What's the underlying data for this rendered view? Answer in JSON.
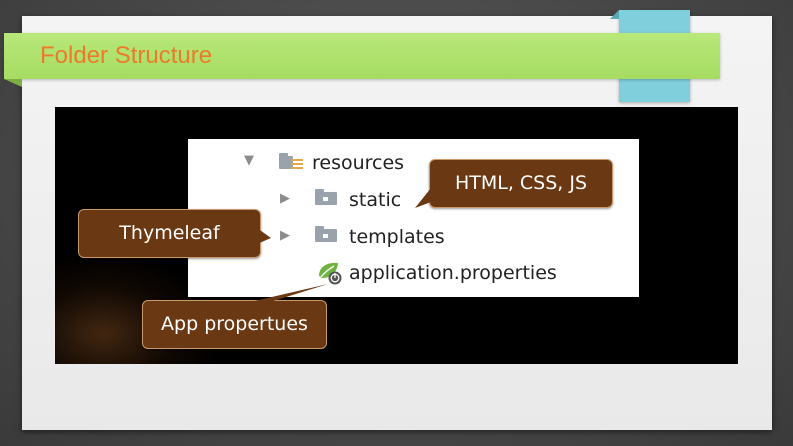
{
  "slide": {
    "title": "Folder Structure"
  },
  "tree": {
    "items": [
      {
        "label": "resources",
        "icon": "resources-folder-icon",
        "expander": "▼"
      },
      {
        "label": "static",
        "icon": "folder-icon",
        "expander": "▶"
      },
      {
        "label": "templates",
        "icon": "folder-icon",
        "expander": "▶"
      },
      {
        "label": "application.properties",
        "icon": "spring-leaf-icon",
        "expander": ""
      }
    ]
  },
  "callouts": {
    "static_note": "HTML, CSS, JS",
    "templates_note": "Thymeleaf",
    "properties_note": "App propertues"
  },
  "colors": {
    "title_band": "#a6dc62",
    "title_text": "#ec7a2a",
    "accent_tab": "#7fcfdc",
    "callout_bg": "#6a3812"
  }
}
